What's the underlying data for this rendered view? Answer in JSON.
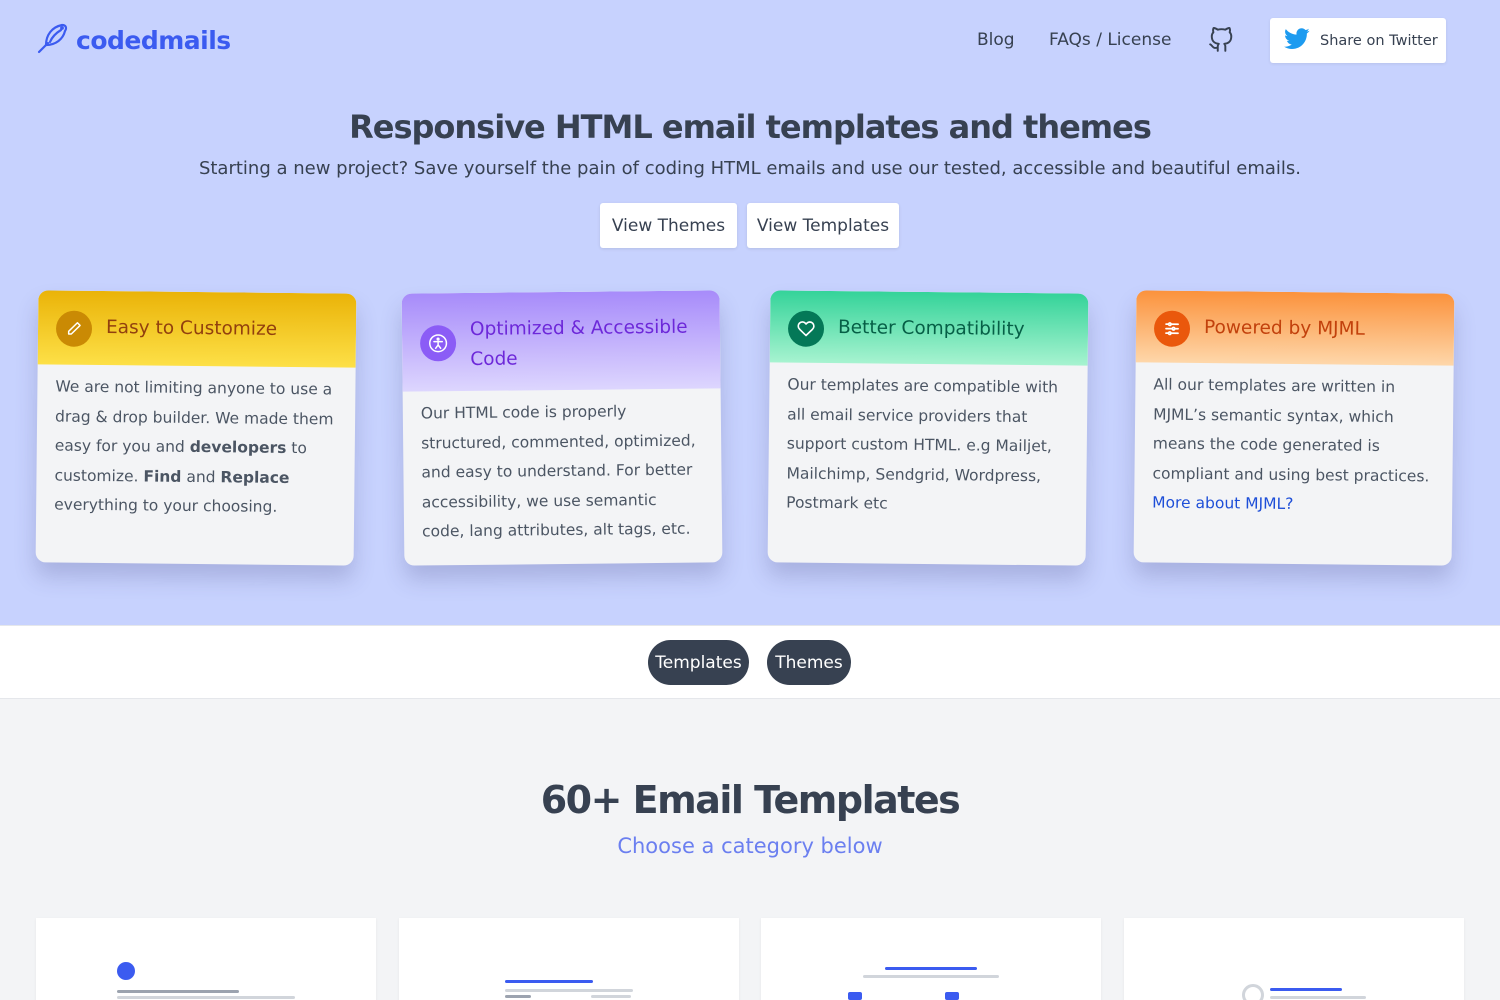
{
  "brand": {
    "name": "codedmails",
    "color": "#3b5bf0",
    "icon": "bird-icon"
  },
  "nav": {
    "blog": "Blog",
    "faqs": "FAQs / License",
    "github_icon": "github-icon",
    "twitter_label": "Share on Twitter",
    "twitter_icon": "twitter-icon"
  },
  "hero": {
    "title": "Responsive HTML email templates and themes",
    "subtitle": "Starting a new project? Save yourself the pain of coding HTML emails and use our tested, accessible and beautiful emails.",
    "view_themes": "View Themes",
    "view_templates": "View Templates",
    "background": "#c7d2fe"
  },
  "features": [
    {
      "title": "Easy to Customize",
      "icon": "pencil-icon",
      "title_color": "#92400e",
      "icon_bg": "#ca8a04",
      "body_parts": {
        "p1": "We are not limiting anyone to use a drag & drop builder. We made them easy for you and ",
        "b1": "developers",
        "p2": " to customize. ",
        "b2": "Find",
        "p3": " and ",
        "b3": "Replace",
        "p4": " everything to your choosing."
      }
    },
    {
      "title": "Optimized & Accessible Code",
      "icon": "accessibility-icon",
      "title_color": "#6d28d9",
      "icon_bg": "#8b5cf6",
      "body": "Our HTML code is properly structured, commented, optimized, and easy to understand. For better accessibility, we use semantic code, lang attributes, alt tags, etc."
    },
    {
      "title": "Better Compatibility",
      "icon": "heart-icon",
      "title_color": "#065f46",
      "icon_bg": "#047857",
      "body": "Our templates are compatible with all email service providers that support custom HTML. e.g Mailjet, Mailchimp, Sendgrid, Wordpress, Postmark etc"
    },
    {
      "title": "Powered by MJML",
      "icon": "list-icon",
      "title_color": "#c2410c",
      "icon_bg": "#ea580c",
      "body": "All our templates are written in MJML’s semantic syntax, which means the code generated is compliant and using best practices. ",
      "link": "More about MJML?"
    }
  ],
  "tabs": {
    "templates": "Templates",
    "themes": "Themes"
  },
  "section": {
    "title": "60+ Email Templates",
    "subtitle": "Choose a category below"
  }
}
